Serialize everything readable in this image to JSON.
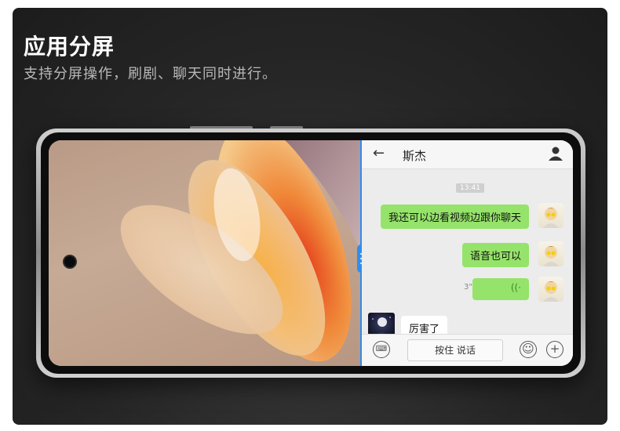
{
  "headline": "应用分屏",
  "subline": "支持分屏操作，刷剧、聊天同时进行。",
  "chat": {
    "contact_name": "斯杰",
    "timestamp": "13:41",
    "messages": [
      {
        "sender": "me",
        "text": "我还可以边看视频边跟你聊天"
      },
      {
        "sender": "me",
        "text": "语音也可以"
      },
      {
        "sender": "me",
        "type": "voice",
        "duration": "3\""
      },
      {
        "sender": "friend",
        "text": "厉害了"
      }
    ],
    "hold_to_talk_label": "按住 说话"
  },
  "icons": {
    "back": "back-arrow-icon",
    "profile": "profile-icon",
    "keyboard": "keyboard-icon",
    "emoji": "emoji-icon",
    "add": "add-icon",
    "voice_wave": "voice-wave-icon"
  },
  "colors": {
    "split_divider": "#2e8ef0",
    "outgoing_bubble": "#95e36a",
    "background": "#262626"
  }
}
